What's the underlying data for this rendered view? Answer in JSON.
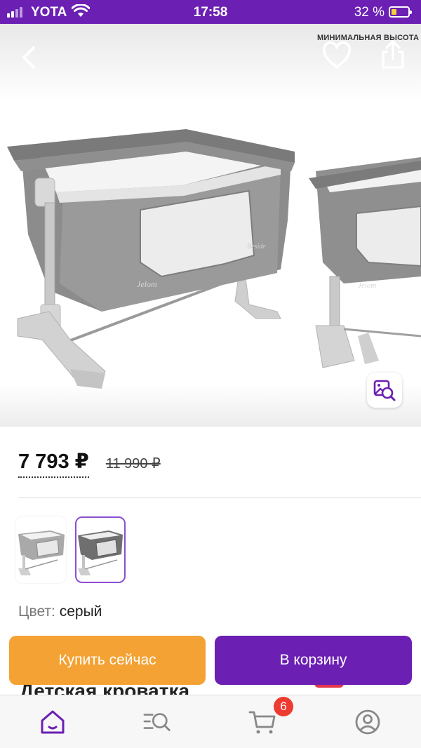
{
  "status_bar": {
    "carrier": "YOTA",
    "time": "17:58",
    "battery_percent": "32 %",
    "battery_level": 0.32
  },
  "gallery": {
    "spec_label": "МИНИМАЛЬНАЯ ВЫСОТА",
    "icons": [
      "back-icon",
      "heart-icon",
      "share-icon",
      "image-search-icon"
    ]
  },
  "price": {
    "current": "7 793 ₽",
    "old": "11 990 ₽"
  },
  "variants": {
    "selected_index": 1,
    "count": 2
  },
  "color": {
    "label": "Цвет:",
    "value": "серый"
  },
  "actions": {
    "buy_now": "Купить сейчас",
    "add_to_cart": "В корзину"
  },
  "title_peek": "Детская кроватка",
  "tab_bar": {
    "cart_count": "6",
    "accent": "#6b1fb3",
    "icons": [
      "home-icon",
      "catalog-search-icon",
      "cart-icon",
      "profile-icon"
    ]
  },
  "colors": {
    "brand_purple": "#6b1fb3",
    "buy_orange": "#f3a233",
    "badge_red": "#ee3a30"
  }
}
